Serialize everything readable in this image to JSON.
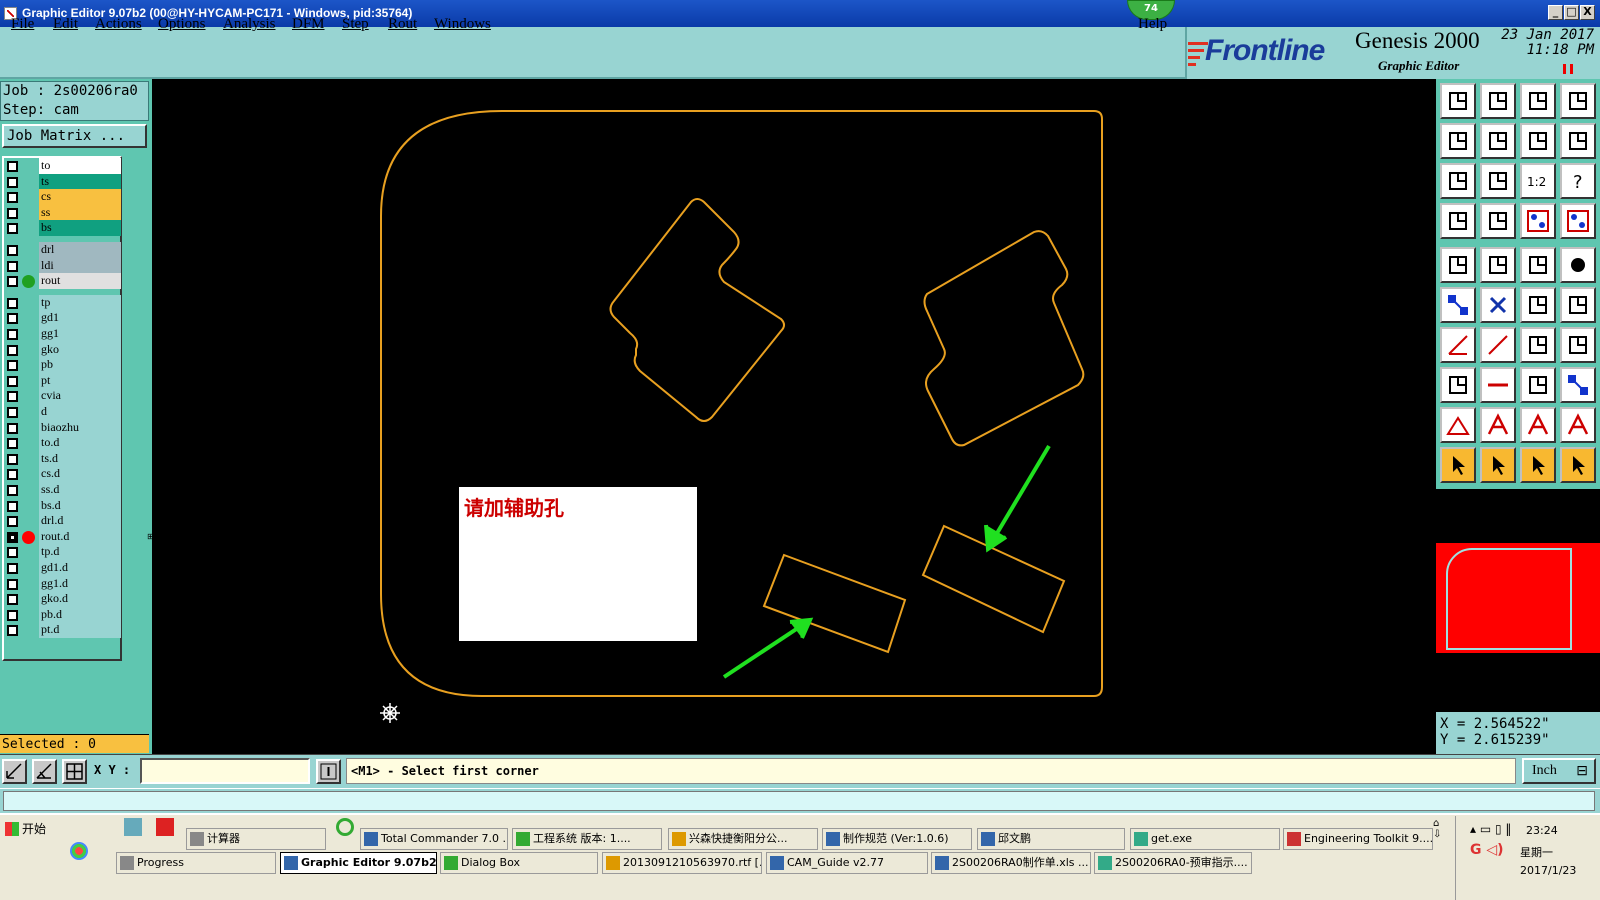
{
  "window": {
    "title": "Graphic Editor 9.07b2 (00@HY-HYCAM-PC171 - Windows, pid:35764)",
    "badge": "74",
    "controls": [
      "_",
      "□",
      "X"
    ]
  },
  "menu": {
    "items": [
      "File",
      "Edit",
      "Actions",
      "Options",
      "Analysis",
      "DFM",
      "Step",
      "Rout",
      "Windows"
    ],
    "help": "Help"
  },
  "branding": {
    "logo": "Frontline",
    "product": "Genesis 2000",
    "subtitle": "Graphic Editor",
    "date": "23 Jan 2017",
    "time": "11:18 PM"
  },
  "job": {
    "job_line": "Job : 2s00206ra0",
    "step_line": "Step: cam",
    "matrix_button": "Job Matrix ..."
  },
  "layers": [
    {
      "name": "to",
      "color": "#ffffff",
      "group": 0
    },
    {
      "name": "ts",
      "color": "#10a080",
      "group": 0
    },
    {
      "name": "cs",
      "color": "#f8c040",
      "group": 0
    },
    {
      "name": "ss",
      "color": "#f8c040",
      "group": 0
    },
    {
      "name": "bs",
      "color": "#10a080",
      "group": 0
    },
    {
      "name": "drl",
      "color": "#a0b8c0",
      "group": 1
    },
    {
      "name": "ldi",
      "color": "#a0b8c0",
      "group": 1
    },
    {
      "name": "rout",
      "color": "#e0e0e0",
      "group": 1,
      "dot": "#20a020"
    },
    {
      "name": "tp",
      "color": "#98d4d2",
      "group": 2
    },
    {
      "name": "gd1",
      "color": "#98d4d2",
      "group": 2
    },
    {
      "name": "gg1",
      "color": "#98d4d2",
      "group": 2
    },
    {
      "name": "gko",
      "color": "#98d4d2",
      "group": 2
    },
    {
      "name": "pb",
      "color": "#98d4d2",
      "group": 2
    },
    {
      "name": "pt",
      "color": "#98d4d2",
      "group": 2
    },
    {
      "name": "cvia",
      "color": "#98d4d2",
      "group": 2
    },
    {
      "name": "d",
      "color": "#98d4d2",
      "group": 2
    },
    {
      "name": "biaozhu",
      "color": "#98d4d2",
      "group": 2
    },
    {
      "name": "to.d",
      "color": "#98d4d2",
      "group": 2
    },
    {
      "name": "ts.d",
      "color": "#98d4d2",
      "group": 2
    },
    {
      "name": "cs.d",
      "color": "#98d4d2",
      "group": 2
    },
    {
      "name": "ss.d",
      "color": "#98d4d2",
      "group": 2
    },
    {
      "name": "bs.d",
      "color": "#98d4d2",
      "group": 2
    },
    {
      "name": "drl.d",
      "color": "#98d4d2",
      "group": 2
    },
    {
      "name": "rout.d",
      "color": "#98d4d2",
      "group": 2,
      "dot": "#ff0000",
      "checked": true,
      "mark": "⊞"
    },
    {
      "name": "tp.d",
      "color": "#98d4d2",
      "group": 2
    },
    {
      "name": "gd1.d",
      "color": "#98d4d2",
      "group": 2
    },
    {
      "name": "gg1.d",
      "color": "#98d4d2",
      "group": 2
    },
    {
      "name": "gko.d",
      "color": "#98d4d2",
      "group": 2
    },
    {
      "name": "pb.d",
      "color": "#98d4d2",
      "group": 2
    },
    {
      "name": "pt.d",
      "color": "#98d4d2",
      "group": 2
    }
  ],
  "selected": "Selected : 0",
  "canvas": {
    "note": "请加辅助孔",
    "outline_color": "#e8a020",
    "arrow_color": "#20e020"
  },
  "coords": {
    "x": "X = 2.564522\"",
    "y": "Y = 2.615239\""
  },
  "command": {
    "xy_label": "X Y :",
    "xy_value": "",
    "prompt": "<M1> - Select first corner",
    "unit": "Inch"
  },
  "taskbar": {
    "start": "开始",
    "row1": [
      "计算器",
      "Total Commander 7.0 ...",
      "工程系统  版本: 1....",
      "兴森快捷衡阳分公...",
      "制作规范 (Ver:1.0.6)",
      "邱文鹏",
      "get.exe",
      "Engineering Toolkit 9...."
    ],
    "row2": [
      "Progress",
      "Graphic Editor 9.07b2 ...",
      "Dialog Box",
      "2013091210563970.rtf [...",
      "CAM_Guide v2.77",
      "2S00206RA0制作单.xls ...",
      "2S00206RA0-预审指示...."
    ],
    "clock": "23:24",
    "weekday": "星期一",
    "date": "2017/1/23"
  }
}
